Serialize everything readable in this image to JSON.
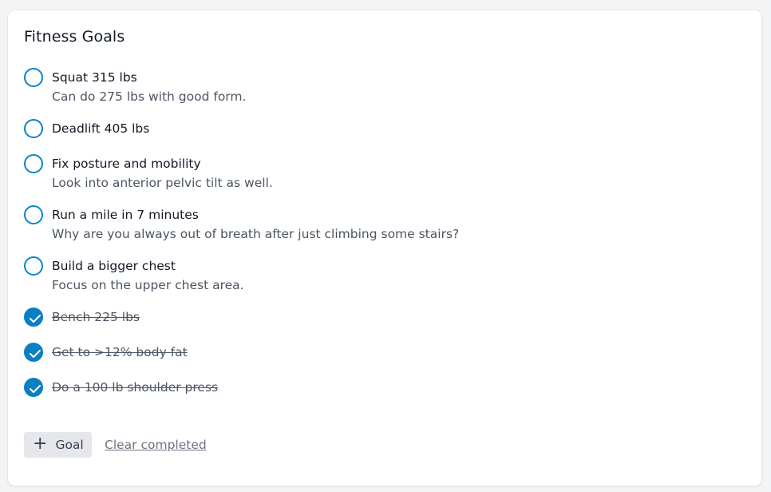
{
  "card": {
    "title": "Fitness Goals"
  },
  "goals": [
    {
      "title": "Squat 315 lbs",
      "description": "Can do 275 lbs with good form.",
      "completed": false
    },
    {
      "title": "Deadlift 405 lbs",
      "description": "",
      "completed": false
    },
    {
      "title": "Fix posture and mobility",
      "description": "Look into anterior pelvic tilt as well.",
      "completed": false
    },
    {
      "title": "Run a mile in 7 minutes",
      "description": "Why are you always out of breath after just climbing some stairs?",
      "completed": false
    },
    {
      "title": "Build a bigger chest",
      "description": "Focus on the upper chest area.",
      "completed": false
    },
    {
      "title": "Bench 225 lbs",
      "description": "",
      "completed": true
    },
    {
      "title": "Get to >12% body fat",
      "description": "",
      "completed": true
    },
    {
      "title": "Do a 100 lb shoulder press",
      "description": "",
      "completed": true
    }
  ],
  "actions": {
    "add_icon": "plus-icon",
    "add_label": "Goal",
    "clear_label": "Clear completed"
  },
  "colors": {
    "accent": "#0a7fc4",
    "background": "#f3f4f6",
    "card": "#ffffff"
  }
}
